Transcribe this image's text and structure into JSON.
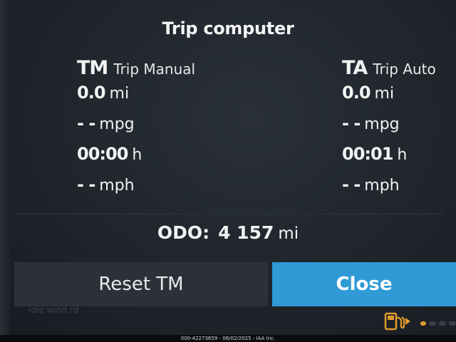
{
  "title": "Trip computer",
  "columns": [
    {
      "abbr": "TM",
      "name": "Trip Manual",
      "distance": {
        "value": "0.0",
        "unit": "mi"
      },
      "economy": {
        "value": "- -",
        "unit": "mpg"
      },
      "time": {
        "value": "00:00",
        "unit": "h"
      },
      "speed": {
        "value": "- -",
        "unit": "mph"
      }
    },
    {
      "abbr": "TA",
      "name": "Trip Auto",
      "distance": {
        "value": "0.0",
        "unit": "mi"
      },
      "economy": {
        "value": "- -",
        "unit": "mpg"
      },
      "time": {
        "value": "00:01",
        "unit": "h"
      },
      "speed": {
        "value": "- -",
        "unit": "mph"
      }
    }
  ],
  "odo": {
    "label": "ODO:",
    "value": "4 157",
    "unit": "mi"
  },
  "buttons": {
    "reset": "Reset TM",
    "close": "Close"
  },
  "ghost_text": "idle wind rd",
  "status": {
    "fuel_icon": "fuel-pump-icon",
    "fuel_color": "#e09d2a"
  },
  "footer": "000-42273659 - 06/02/2025 - IAA Inc.",
  "colors": {
    "close_button": "#2f9ad6",
    "reset_button": "#2c3139",
    "background": "#1b1f26"
  }
}
